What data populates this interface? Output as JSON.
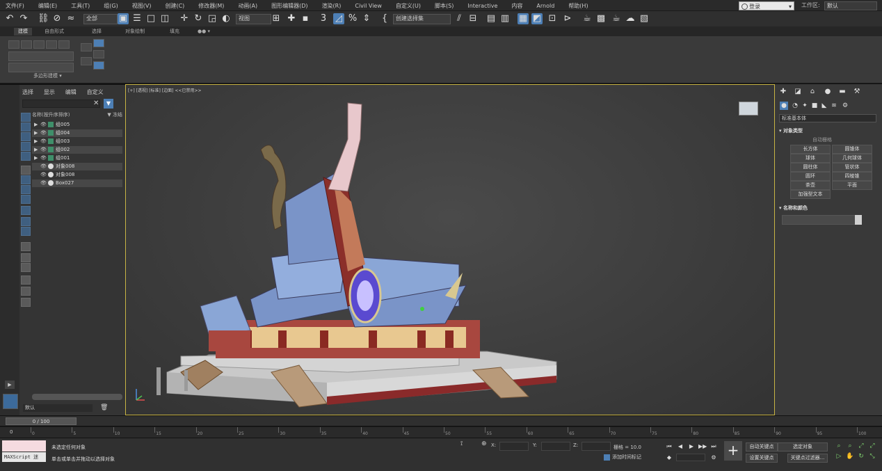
{
  "menubar": {
    "items": [
      "文件(F)",
      "编辑(E)",
      "工具(T)",
      "组(G)",
      "视图(V)",
      "创建(C)",
      "修改器(M)",
      "动画(A)",
      "图形编辑器(D)",
      "渲染(R)",
      "Civil View",
      "自定义(U)",
      "脚本(S)",
      "Interactive",
      "内容",
      "Arnold",
      "帮助(H)"
    ],
    "signin_label": "登录",
    "workspace_label": "工作区:",
    "workspace_value": "默认"
  },
  "toolbar": {
    "selection_filter": "全部",
    "ref_coord": "视图",
    "named_selection": "创建选择集"
  },
  "ribbon": {
    "tabs": [
      "建模",
      "自由形式",
      "选择",
      "对象绘制",
      "填充"
    ],
    "panel_label": "多边形建模"
  },
  "explorer": {
    "menu": [
      "选择",
      "显示",
      "编辑",
      "自定义"
    ],
    "column_header": "名称(按升序排序)",
    "sort_label": "▼ 冻结",
    "rows": [
      {
        "label": "组005",
        "group": true
      },
      {
        "label": "组004",
        "group": true
      },
      {
        "label": "组003",
        "group": true
      },
      {
        "label": "组002",
        "group": true
      },
      {
        "label": "组001",
        "group": true
      },
      {
        "label": "对象008",
        "group": false
      },
      {
        "label": "对象008",
        "group": false
      },
      {
        "label": "Box027",
        "group": false
      }
    ],
    "layer": "默认"
  },
  "viewport": {
    "label": "[+] [透视] [标准] [边面] <<已禁用>>"
  },
  "command_panel": {
    "dropdown": "标准基本体",
    "rollout_object_type": "对象类型",
    "autogrid": "自动栅格",
    "buttons": [
      "长方体",
      "圆锥体",
      "球体",
      "几何球体",
      "圆柱体",
      "管状体",
      "圆环",
      "四棱锥",
      "茶壶",
      "平面",
      "加强型文本"
    ],
    "rollout_name_color": "名称和颜色"
  },
  "timeline": {
    "slider": "0 / 100",
    "start": "0",
    "ticks": [
      "0",
      "5",
      "10",
      "15",
      "20",
      "25",
      "30",
      "35",
      "40",
      "45",
      "50",
      "55",
      "60",
      "65",
      "70",
      "75",
      "80",
      "85",
      "90",
      "95",
      "100"
    ]
  },
  "status": {
    "script_label": "MAXScript 迷",
    "line1": "未选定任何对象",
    "line2": "单击或单击并拖动以选择对象",
    "x_label": "X:",
    "y_label": "Y:",
    "z_label": "Z:",
    "grid_label": "栅格 = 10.0",
    "add_time_tag": "添加时间标记",
    "auto_key": "自动关键点",
    "selected_object": "选定对象",
    "set_key": "设置关键点",
    "key_filter": "关键点过滤器..."
  }
}
